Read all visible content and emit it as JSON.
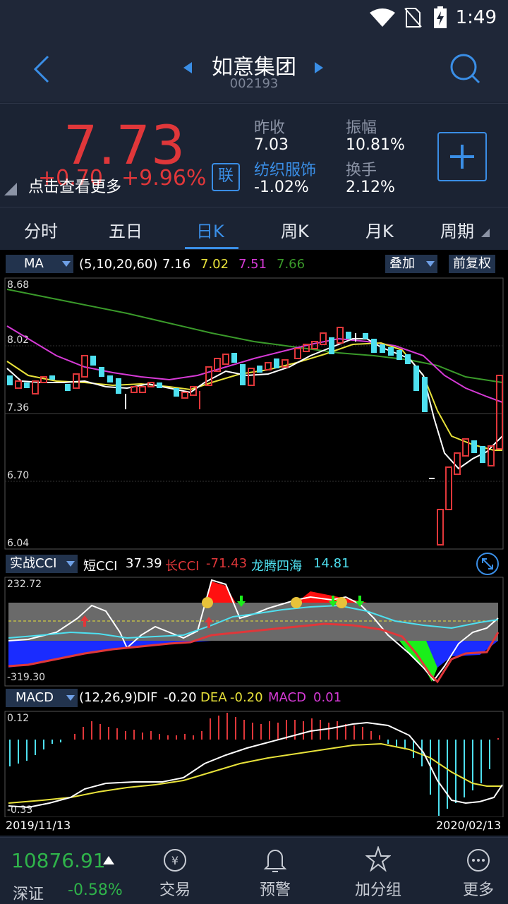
{
  "status": {
    "time": "1:49"
  },
  "nav": {
    "title": "如意集团",
    "code": "002193"
  },
  "quote": {
    "price": "7.73",
    "change": "+0.70",
    "change_pct": "+9.96%",
    "hint": "点击查看更多",
    "link_button": "联",
    "prev_close_label": "昨收",
    "prev_close": "7.03",
    "sector": "纺织服饰",
    "sector_change": "-1.02%",
    "amplitude_label": "振幅",
    "amplitude": "10.81%",
    "turnover_label": "换手",
    "turnover": "2.12%"
  },
  "tabs": [
    "分时",
    "五日",
    "日K",
    "周K",
    "月K",
    "周期"
  ],
  "active_tab": "日K",
  "ma": {
    "selector": "MA",
    "params": "(5,10,20,60)",
    "v5": "7.16",
    "v10": "7.02",
    "v20": "7.51",
    "v60": "7.66",
    "overlay": "叠加",
    "adjust": "前复权",
    "colors": {
      "ma5": "#ffffff",
      "ma10": "#e8e23a",
      "ma20": "#d63ad6",
      "ma60": "#3a9a2a"
    },
    "y_ticks": [
      "8.68",
      "8.02",
      "7.36",
      "6.70",
      "6.04"
    ]
  },
  "cci": {
    "selector": "实战CCI",
    "short_label": "短CCI",
    "short_val": "37.39",
    "long_label": "长CCI",
    "long_val": "-71.43",
    "dragon_label": "龙腾四海",
    "dragon_val": "14.81",
    "y_max": "232.72",
    "y_min": "-319.30"
  },
  "macd": {
    "selector": "MACD",
    "params": "(12,26,9)",
    "dif_label": "DIF",
    "dif": "-0.20",
    "dea_label": "DEA",
    "dea": "-0.20",
    "macd_label": "MACD",
    "macd_val": "0.01",
    "y_max": "0.12",
    "y_min": "-0.33",
    "date_start": "2019/11/13",
    "date_end": "2020/02/13"
  },
  "bottom": {
    "index_value": "10876.91",
    "index_name": "深证",
    "index_change": "-0.58%",
    "items": [
      "交易",
      "预警",
      "加分组",
      "更多"
    ]
  }
}
